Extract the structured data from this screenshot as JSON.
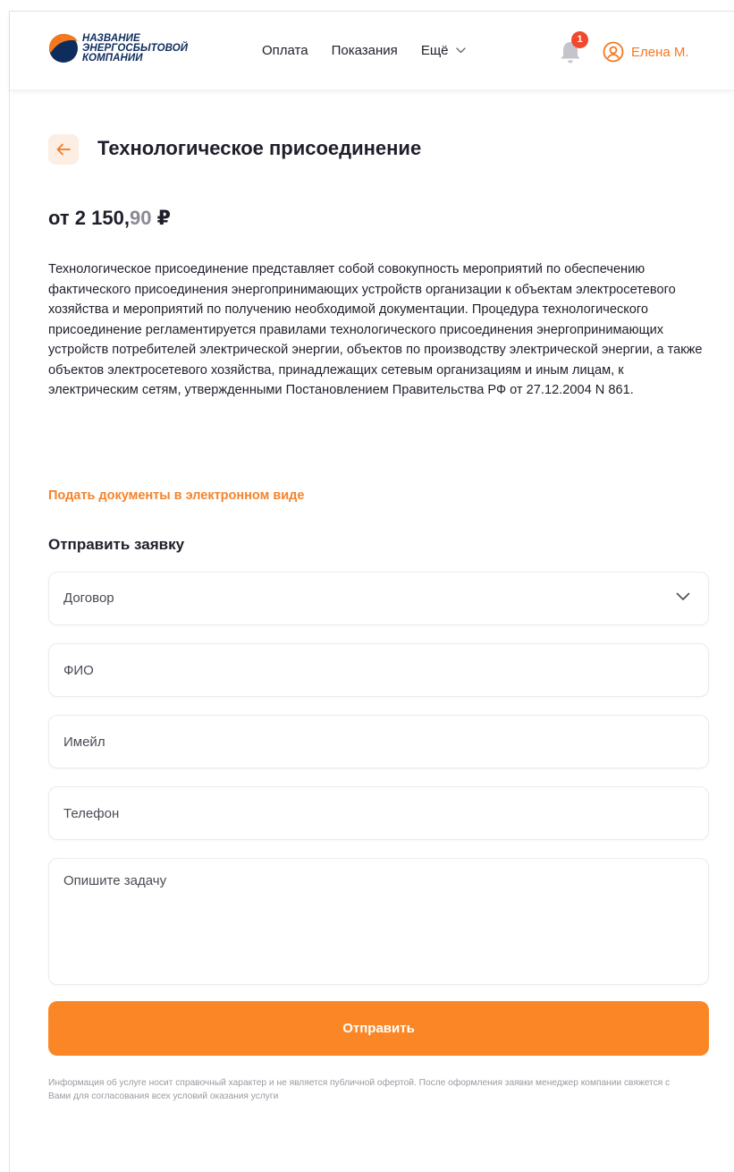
{
  "header": {
    "logo": {
      "line1": "НАЗВАНИЕ",
      "line2": "ЭНЕРГОСБЫТОВОЙ",
      "line3": "КОМПАНИИ"
    },
    "nav": [
      {
        "label": "Оплата"
      },
      {
        "label": "Показания"
      }
    ],
    "more_label": "Ещё",
    "notifications_count": "1",
    "user_name": "Елена М."
  },
  "page": {
    "title": "Технологическое присоединение",
    "price_prefix": "от 2 150,",
    "price_decimals": "90",
    "price_currency": "₽",
    "description": "Технологическое присоединение представляет собой совокупность мероприятий по обеспечению фактического присоединения энергопринимающих устройств организации к объектам электросетевого хозяйства и мероприятий по получению необходимой документации. Процедура технологического присоединение регламентируется правилами технологического присоединения энергопринимающих устройств потребителей электрической энергии, объектов по производству электрической энергии, а также объектов электросетевого хозяйства, принадлежащих сетевым организациям и иным лицам, к электрическим сетям, утвержденными Постановлением Правительства РФ от 27.12.2004 N 861.",
    "docs_link": "Подать документы в электронном виде"
  },
  "form": {
    "title": "Отправить заявку",
    "contract_placeholder": "Договор",
    "name_placeholder": "ФИО",
    "email_placeholder": "Имейл",
    "phone_placeholder": "Телефон",
    "task_placeholder": "Опишите задачу",
    "submit_label": "Отправить",
    "disclaimer": "Информация об услуге носит справочный характер и не является публичной офертой. После оформления заявки менеджер компании свяжется с Вами для согласования всех условий оказания услуги"
  },
  "colors": {
    "accent": "#fb8626",
    "brand_navy": "#0f2d5c",
    "badge": "#f0492f"
  },
  "icons": {
    "logo": "company-logo-icon",
    "bell": "bell-icon",
    "user": "user-circle-icon",
    "back": "arrow-left-icon",
    "chevron": "chevron-down-icon"
  }
}
